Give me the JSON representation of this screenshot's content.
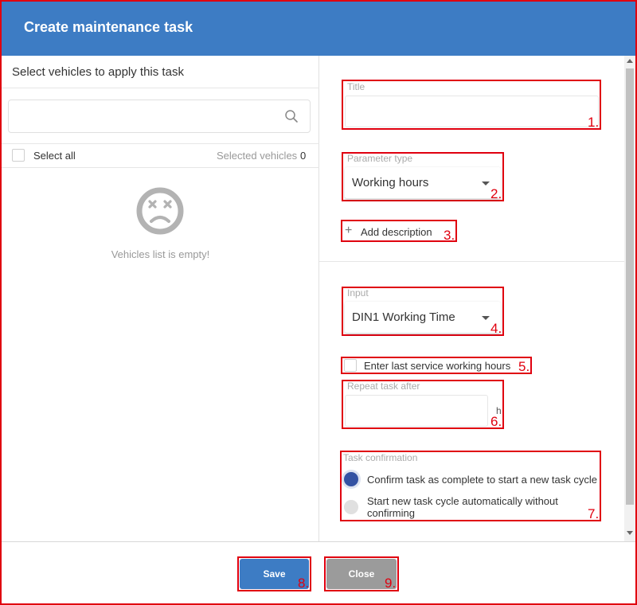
{
  "dialog": {
    "title": "Create maintenance task"
  },
  "left_panel": {
    "heading": "Select vehicles to apply this task",
    "search": {
      "value": "",
      "placeholder": "",
      "icon": "search-icon"
    },
    "select_all_label": "Select all",
    "selected_label": "Selected vehicles",
    "selected_count": "0",
    "empty_icon": "sad-face-icon",
    "empty_text": "Vehicles list is empty!"
  },
  "form": {
    "title_field": {
      "label": "Title",
      "value": ""
    },
    "parameter_type": {
      "label": "Parameter type",
      "value": "Working hours"
    },
    "add_description": {
      "icon": "plus-icon",
      "label": "Add description"
    },
    "input": {
      "label": "Input",
      "value": "DIN1 Working Time"
    },
    "last_service_checkbox": {
      "label": "Enter last service working hours",
      "checked": false
    },
    "repeat_after": {
      "label": "Repeat task after",
      "value": "",
      "unit": "h"
    },
    "task_confirmation": {
      "label": "Task confirmation",
      "options": [
        {
          "label": "Confirm task as complete to start a new task cycle",
          "selected": true
        },
        {
          "label": "Start new task cycle automatically without confirming",
          "selected": false
        }
      ]
    }
  },
  "footer": {
    "save_label": "Save",
    "close_label": "Close"
  },
  "annotations": [
    "1.",
    "2.",
    "3.",
    "4.",
    "5.",
    "6.",
    "7.",
    "8.",
    "9."
  ],
  "colors": {
    "header": "#3d7cc4",
    "highlight": "#e0000f",
    "save_button": "#3d7cc4",
    "close_button": "#9b9b9b",
    "radio_selected": "#3452a3"
  }
}
